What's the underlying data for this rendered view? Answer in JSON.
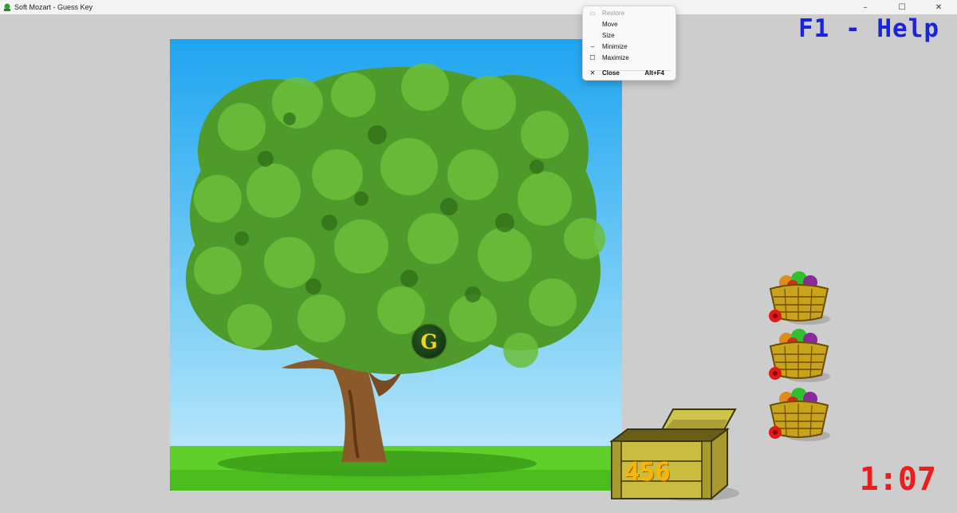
{
  "window": {
    "title": "Soft Mozart - Guess Key",
    "controls": {
      "minimize": "–",
      "maximize": "☐",
      "close": "✕"
    }
  },
  "help": {
    "label": "F1 - Help"
  },
  "game": {
    "note_label": "G",
    "score": "456",
    "timer": "1:07",
    "baskets_remaining": 3
  },
  "context_menu": {
    "items": [
      {
        "icon": "▭",
        "label": "Restore",
        "shortcut": "",
        "enabled": false
      },
      {
        "icon": "",
        "label": "Move",
        "shortcut": "",
        "enabled": true
      },
      {
        "icon": "",
        "label": "Size",
        "shortcut": "",
        "enabled": true
      },
      {
        "icon": "–",
        "label": "Minimize",
        "shortcut": "",
        "enabled": true
      },
      {
        "icon": "☐",
        "label": "Maximize",
        "shortcut": "",
        "enabled": true
      },
      {
        "icon": "✕",
        "label": "Close",
        "shortcut": "Alt+F4",
        "enabled": true
      }
    ]
  },
  "colors": {
    "help_text": "#1a24e0",
    "timer_text": "#ee1c1c",
    "score_text": "#ffb400",
    "note_text": "#f5d21a"
  }
}
